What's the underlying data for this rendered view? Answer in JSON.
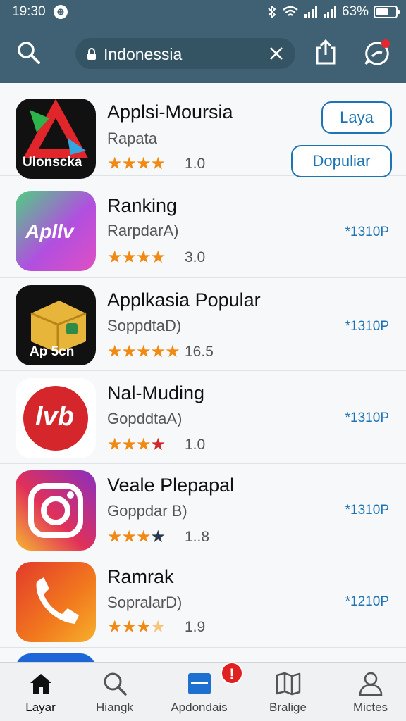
{
  "status_bar": {
    "time": "19:30",
    "battery_pct": "63%",
    "battery_level": 0.63
  },
  "header": {
    "search": {
      "value": "Indonessia",
      "placeholder": ""
    },
    "icons": [
      "search-icon",
      "lock-icon",
      "close-icon",
      "share-icon",
      "chat-icon"
    ]
  },
  "apps": [
    {
      "title": "Applsi-Moursia",
      "subtitle": "Rapata",
      "stars": 3.5,
      "rating": "1.0",
      "icon_text": "Ulonscka",
      "buttons": [
        "Laya",
        "Dopuliar"
      ]
    },
    {
      "title": "Ranking",
      "subtitle": "RarpdarA)",
      "stars": 4,
      "rating": "3.0",
      "icon_text": "Apllv",
      "price": "*1310P"
    },
    {
      "title": "Applkasia Popular",
      "subtitle": "SoppdtaD)",
      "stars": 5,
      "rating": "16.5",
      "icon_text": "Ap 5cn",
      "price": "*1310P"
    },
    {
      "title": "Nal-Muding",
      "subtitle": "GopddtaA)",
      "stars": 3.5,
      "rating": "1.0",
      "icon_text": "lvb",
      "price": "*1310P"
    },
    {
      "title": "Veale Plepapal",
      "subtitle": "Goppdar B)",
      "stars": 3,
      "rating": "1..8",
      "icon_text": "",
      "price": "*1310P"
    },
    {
      "title": "Ramrak",
      "subtitle": "SopralarD)",
      "stars": 3.5,
      "rating": "1.9",
      "icon_text": "",
      "price": "*1210P"
    }
  ],
  "nav": [
    {
      "label": "Layar",
      "icon": "home-icon",
      "active": true
    },
    {
      "label": "Hiangk",
      "icon": "search-icon"
    },
    {
      "label": "Apdondais",
      "icon": "apps-icon",
      "badge": "!"
    },
    {
      "label": "Bralige",
      "icon": "book-icon"
    },
    {
      "label": "Mictes",
      "icon": "profile-icon"
    }
  ],
  "colors": {
    "header": "#3f6173",
    "accent": "#1d74b5",
    "star": "#f08a12",
    "badge": "#e02121"
  }
}
